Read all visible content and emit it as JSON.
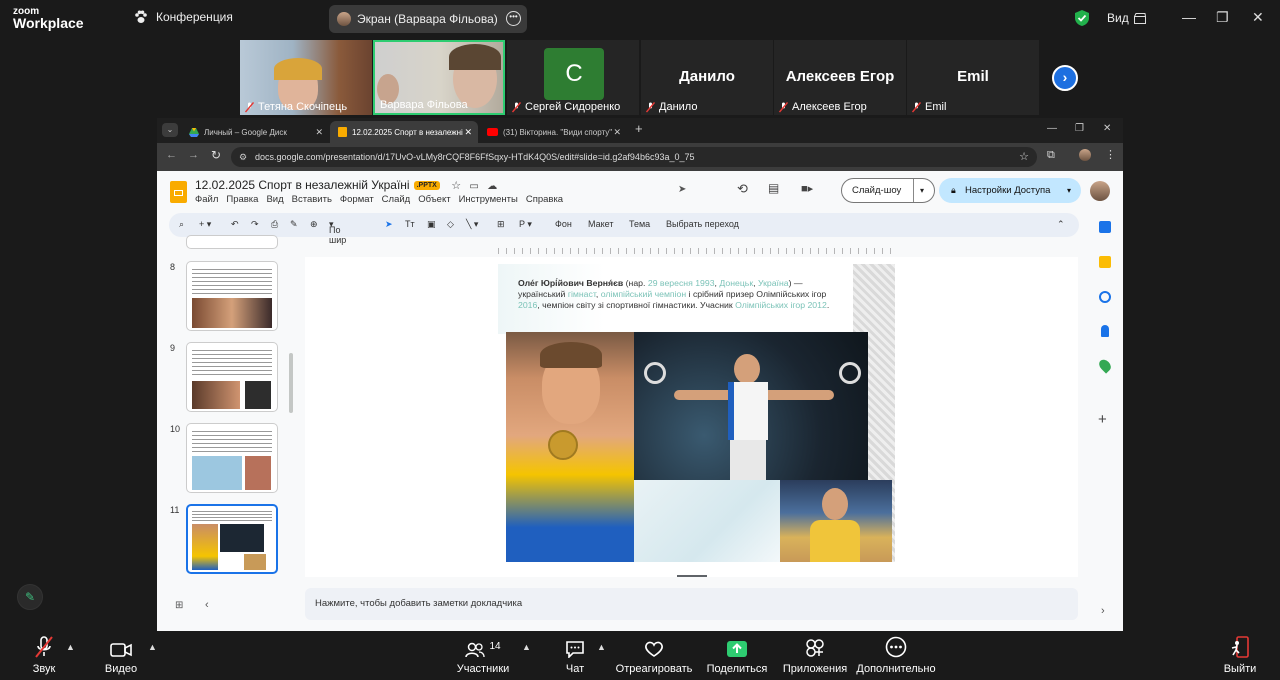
{
  "zoom": {
    "logo_line1": "zoom",
    "logo_line2": "Workplace",
    "meeting_label": "Конференция",
    "share_label": "Экран (Варвара Фільова)",
    "view_label": "Вид",
    "participants": [
      {
        "name": "Тетяна Скочіпець",
        "muted": true,
        "video": true
      },
      {
        "name": "Варвара Фільова",
        "muted": false,
        "video": true,
        "speaking": true
      },
      {
        "name": "Сергей Сидоренко",
        "muted": true,
        "video": false,
        "initial": "C",
        "avatar_color": "#2e7d32"
      },
      {
        "name": "Данило",
        "muted": true,
        "video": false
      },
      {
        "name": "Алексеев Егор",
        "muted": true,
        "video": false
      },
      {
        "name": "Emil",
        "muted": true,
        "video": false
      }
    ],
    "bottom": {
      "audio": "Звук",
      "video": "Видео",
      "participants": "Участники",
      "participants_count": "14",
      "chat": "Чат",
      "react": "Отреагировать",
      "share": "Поделиться",
      "apps": "Приложения",
      "more": "Дополнительно",
      "leave": "Выйти"
    }
  },
  "browser": {
    "tabs": [
      {
        "title": "Личный – Google Диск",
        "icon": "drive-icon"
      },
      {
        "title": "12.02.2025 Спорт в незалежні",
        "icon": "slides-icon",
        "active": true
      },
      {
        "title": "(31) Вікторина. \"Види спорту\"",
        "icon": "youtube-icon"
      }
    ],
    "url": "docs.google.com/presentation/d/17UvO-vLMy8rCQF8F6FfSqxy-HTdK4Q0S/edit#slide=id.g2af94b6c93a_0_75"
  },
  "slides": {
    "doc_title": "12.02.2025  Спорт в незалежній Україні",
    "badge": ".PPTX",
    "menu": [
      "Файл",
      "Правка",
      "Вид",
      "Вставить",
      "Формат",
      "Слайд",
      "Объект",
      "Инструменты",
      "Справка"
    ],
    "slideshow_label": "Слайд-шоу",
    "access_label": "Настройки Доступа",
    "toolbar": {
      "zoom": "По шир",
      "background": "Фон",
      "layout": "Макет",
      "theme": "Тема",
      "transition": "Выбрать переход"
    },
    "thumb_numbers": [
      "8",
      "9",
      "10",
      "11"
    ],
    "selected_slide": "11",
    "slide_text": {
      "name_bold": "Оле́г Юрі́йович Верня́єв",
      "p1": " (нар. ",
      "date": "29 вересня 1993",
      "p2": ", ",
      "city": "Донецьк",
      "p3": ", ",
      "country": "Україна",
      "p4": ") — український ",
      "gymnast": "гімнаст",
      "p5": ", ",
      "champion": "олімпійський чемпіон",
      "p6": " і срібний призер Олімпійських ігор ",
      "year2016": "2016",
      "p7": ", чемпіон світу зі спортивної гімнастики. Учасник ",
      "games2012": "Олімпійських ігор 2012",
      "p8": "."
    },
    "notes_placeholder": "Нажмите, чтобы добавить заметки докладчика"
  }
}
